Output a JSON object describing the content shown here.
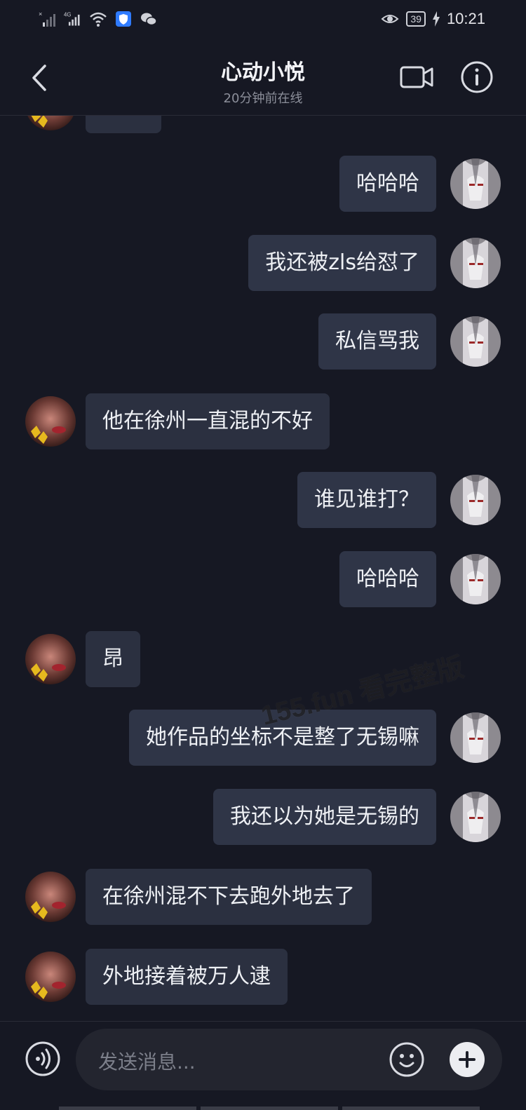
{
  "status_bar": {
    "time": "10:21",
    "battery": "39",
    "network": "4G",
    "icons": [
      "no-sim-signal-icon",
      "signal-4g-icon",
      "wifi-icon",
      "shield-app-icon",
      "wechat-icon",
      "eye-icon",
      "battery-icon",
      "charging-icon"
    ]
  },
  "header": {
    "title": "心动小悦",
    "subtitle": "20分钟前在线"
  },
  "messages": [
    {
      "side": "in",
      "text": ""
    },
    {
      "side": "out",
      "text": "哈哈哈"
    },
    {
      "side": "out",
      "text": "我还被zls给怼了"
    },
    {
      "side": "out",
      "text": "私信骂我"
    },
    {
      "side": "in",
      "text": "他在徐州一直混的不好"
    },
    {
      "side": "out",
      "text": "谁见谁打？"
    },
    {
      "side": "out",
      "text": "哈哈哈"
    },
    {
      "side": "in",
      "text": "昂"
    },
    {
      "side": "out",
      "text": "她作品的坐标不是整了无锡嘛"
    },
    {
      "side": "out",
      "text": "我还以为她是无锡的"
    },
    {
      "side": "in",
      "text": "在徐州混不下去跑外地去了"
    },
    {
      "side": "in",
      "text": "外地接着被万人逮"
    }
  ],
  "watermark": "155.fun 看完整版",
  "input": {
    "placeholder": "发送消息..."
  },
  "colors": {
    "background": "#161823",
    "bubble": "#2b3040",
    "text": "#eef0f4",
    "muted": "#8c8f9a"
  }
}
